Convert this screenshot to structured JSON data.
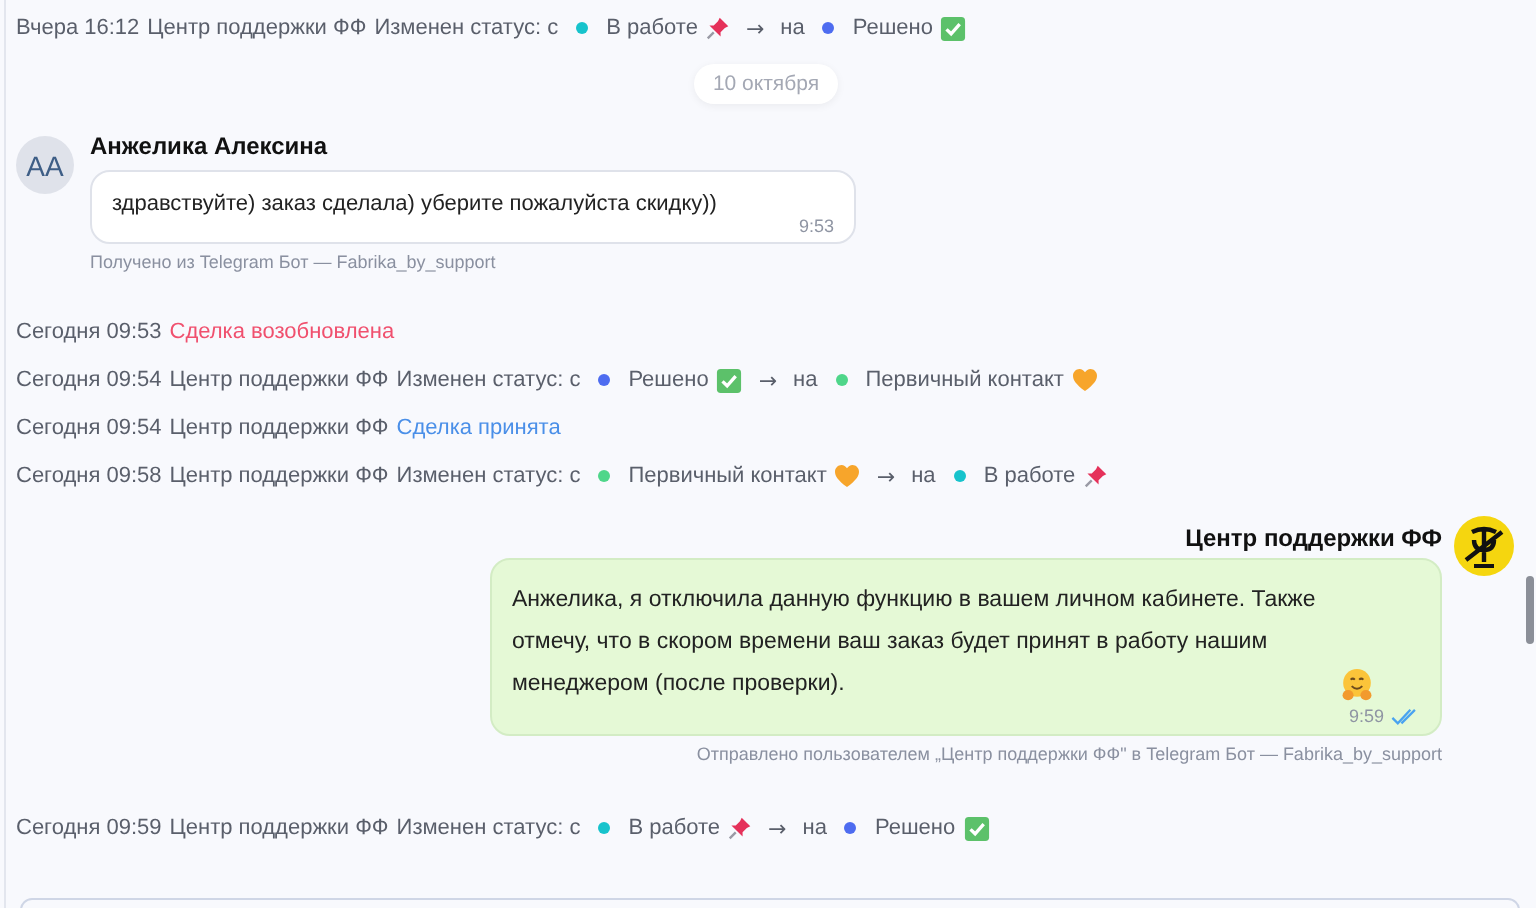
{
  "events": [
    {
      "kind": "status",
      "time": "Вчера 16:12",
      "actor": "Центр поддержки ФФ",
      "action": "Изменен статус: с",
      "from": {
        "name": "В работе",
        "color": "#17c3cc",
        "kind": "pin"
      },
      "arrow": "→",
      "to_word": "на",
      "to": {
        "name": "Решено",
        "color": "#4e6cf0",
        "kind": "check"
      }
    },
    {
      "kind": "date",
      "text": "10 октября"
    },
    {
      "kind": "incoming",
      "initials": "АА",
      "author": "Анжелика Алексина",
      "text": "здравствуйте) заказ сделала) уберите пожалуйста скидку))",
      "time": "9:53",
      "caption": "Получено из Telegram Бот — Fabrika_by_support"
    },
    {
      "kind": "note",
      "time": "Сегодня 09:53",
      "text": "Сделка возобновлена",
      "color": "#f0506e"
    },
    {
      "kind": "status",
      "time": "Сегодня 09:54",
      "actor": "Центр поддержки ФФ",
      "action": "Изменен статус: с",
      "from": {
        "name": "Решено",
        "color": "#4e6cf0",
        "kind": "check"
      },
      "arrow": "→",
      "to_word": "на",
      "to": {
        "name": "Первичный контакт",
        "color": "#4fd68a",
        "kind": "heart"
      }
    },
    {
      "kind": "note",
      "time": "Сегодня 09:54",
      "actor": "Центр поддержки ФФ",
      "text": "Сделка принята",
      "color": "#4a8fe8"
    },
    {
      "kind": "status",
      "time": "Сегодня 09:58",
      "actor": "Центр поддержки ФФ",
      "action": "Изменен статус: с",
      "from": {
        "name": "Первичный контакт",
        "color": "#4fd68a",
        "kind": "heart"
      },
      "arrow": "→",
      "to_word": "на",
      "to": {
        "name": "В работе",
        "color": "#17c3cc",
        "kind": "pin"
      }
    },
    {
      "kind": "outgoing",
      "author": "Центр поддержки ФФ",
      "text": "Анжелика, я отключила данную функцию в вашем личном кабинете. Также отмечу, что в скором времени ваш заказ будет принят в работу нашим менеджером (после проверки).",
      "attachment": {
        "kind": "hug"
      },
      "time": "9:59",
      "read": true,
      "caption": "Отправлено пользователем „Центр поддержки ФФ\" в Telegram Бот — Fabrika_by_support"
    },
    {
      "kind": "status",
      "time": "Сегодня 09:59",
      "actor": "Центр поддержки ФФ",
      "action": "Изменен статус: с",
      "from": {
        "name": "В работе",
        "color": "#17c3cc",
        "kind": "pin"
      },
      "arrow": "→",
      "to_word": "на",
      "to": {
        "name": "Решено",
        "color": "#4e6cf0",
        "kind": "check"
      }
    }
  ]
}
